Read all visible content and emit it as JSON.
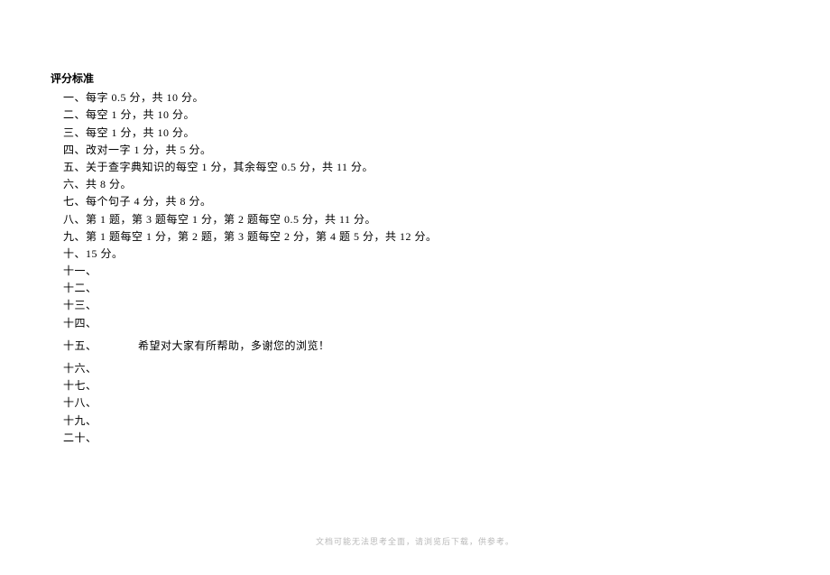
{
  "heading": "评分标准",
  "lines": {
    "l1": "一、每字 0.5 分，共 10 分。",
    "l2": "二、每空 1 分，共 10 分。",
    "l3": "三、每空 1 分，共 10 分。",
    "l4": "四、改对一字 1 分，共 5 分。",
    "l5": "五、关于查字典知识的每空 1 分，其余每空 0.5 分，共 11 分。",
    "l6": "六、共 8 分。",
    "l7": "七、每个句子 4 分，共 8 分。",
    "l8": "八、第 1 题，第 3 题每空 1 分，第 2 题每空 0.5 分，共 11 分。",
    "l9": "九、第 1 题每空 1 分，第 2 题，第 3 题每空 2 分，第 4 题 5 分，共 12 分。",
    "l10": "十、15 分。",
    "l11": "十一、",
    "l12": "十二、",
    "l13": "十三、",
    "l14": "十四、",
    "l15_prefix": "十五、",
    "l15_note": "希望对大家有所帮助，多谢您的浏览！",
    "l16": "十六、",
    "l17": "十七、",
    "l18": "十八、",
    "l19": "十九、",
    "l20": "二十、"
  },
  "footer": "文档可能无法思考全面，请浏览后下载，供参考。"
}
